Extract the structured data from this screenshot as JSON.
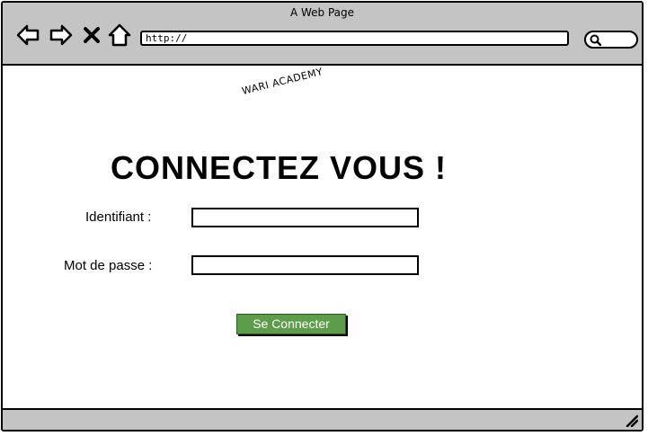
{
  "window": {
    "title": "A Web Page"
  },
  "navigation": {
    "back_icon": "arrow-left-icon",
    "forward_icon": "arrow-right-icon",
    "stop_icon": "close-icon",
    "home_icon": "home-icon"
  },
  "address_bar": {
    "value": "http://"
  },
  "search": {
    "icon": "search-icon"
  },
  "page": {
    "brand": "WARI ACADEMY",
    "heading": "CONNECTEZ VOUS !",
    "form": {
      "username_label": "Identifiant :",
      "username_value": "",
      "password_label": "Mot de passe :",
      "password_value": "",
      "submit_label": "Se Connecter"
    }
  },
  "colors": {
    "chrome": "#c4c4c4",
    "button": "#5d9c4a",
    "button_text": "#ffffff"
  }
}
